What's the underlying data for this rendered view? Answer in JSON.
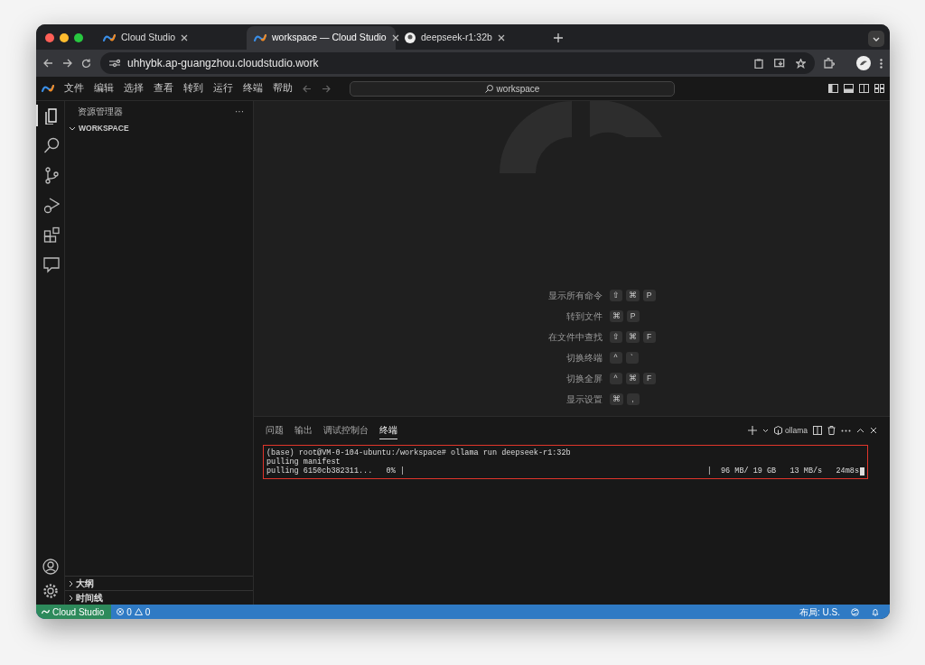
{
  "browser_tabs": [
    {
      "title": "Cloud Studio",
      "kind": "logo",
      "selected": false
    },
    {
      "title": "workspace — Cloud Studio",
      "kind": "logo",
      "selected": true
    },
    {
      "title": "deepseek-r1:32b",
      "kind": "avatar",
      "selected": false
    }
  ],
  "address": "uhhybk.ap-guangzhou.cloudstudio.work",
  "menu": [
    "文件",
    "编辑",
    "选择",
    "查看",
    "转到",
    "运行",
    "终端",
    "帮助"
  ],
  "command_center": "workspace",
  "activity_bar": [
    {
      "kind": "explorer",
      "selected": true
    },
    {
      "kind": "search",
      "selected": false
    },
    {
      "kind": "git",
      "selected": false
    },
    {
      "kind": "debug",
      "selected": false
    },
    {
      "kind": "extensions",
      "selected": false
    },
    {
      "kind": "chat",
      "selected": false
    }
  ],
  "sidebar": {
    "title": "资源管理器",
    "more": "···",
    "section": "WORKSPACE",
    "bottom_sections": [
      "大纲",
      "时间线"
    ]
  },
  "shortcuts": [
    {
      "label": "显示所有命令",
      "keys": [
        "⇧",
        "⌘",
        "P"
      ]
    },
    {
      "label": "转到文件",
      "keys": [
        "⌘",
        "P"
      ]
    },
    {
      "label": "在文件中查找",
      "keys": [
        "⇧",
        "⌘",
        "F"
      ]
    },
    {
      "label": "切换终端",
      "keys": [
        "^",
        "`"
      ]
    },
    {
      "label": "切换全屏",
      "keys": [
        "^",
        "⌘",
        "F"
      ]
    },
    {
      "label": "显示设置",
      "keys": [
        "⌘",
        ","
      ]
    }
  ],
  "panel": {
    "tabs": [
      {
        "label": "问题",
        "selected": false
      },
      {
        "label": "输出",
        "selected": false
      },
      {
        "label": "调试控制台",
        "selected": false
      },
      {
        "label": "终端",
        "selected": true
      }
    ],
    "terminal_name": "ollama",
    "lines": [
      "(base) root@VM-0-104-ubuntu:/workspace# ollama run deepseek-r1:32b",
      "pulling manifest"
    ],
    "progress": {
      "left": "pulling 6150cb382311...   0% |",
      "right": "|  96 MB/ 19 GB   13 MB/s   24m8s"
    }
  },
  "status_bar": {
    "remote": "Cloud Studio",
    "errors": "0",
    "warnings": "0",
    "layout": "布局: U.S."
  }
}
